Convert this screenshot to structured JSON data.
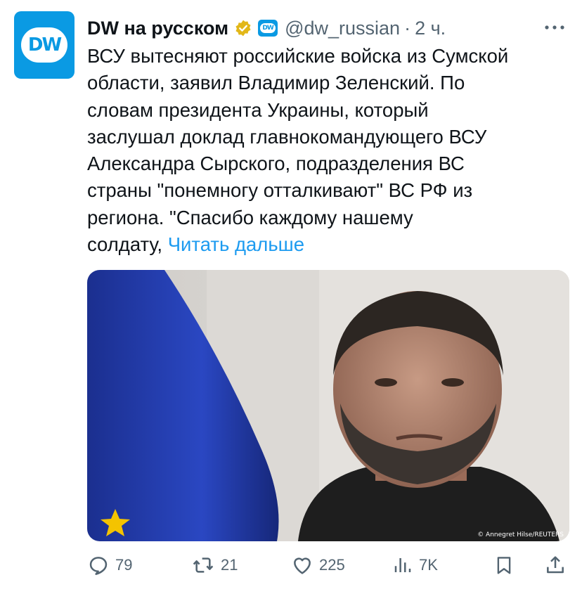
{
  "author": {
    "name": "DW на русском",
    "handle": "@dw_russian",
    "separator": "·",
    "time": "2 ч.",
    "avatar_text": "DW",
    "affiliate_text": "DW"
  },
  "tweet": {
    "lines": [
      "ВСУ вытесняют российские войска из Сумской",
      "области, заявил Владимир Зеленский. По",
      "словам президента Украины, который",
      "заслушал доклад главнокомандующего ВСУ",
      "Александра Сырского, подразделения ВС",
      "страны \"понемногу отталкивают\" ВС РФ из",
      "региона. \"Спасибо каждому нашему",
      "солдату, "
    ],
    "read_more": "Читать дальше"
  },
  "media": {
    "credit": "© Annegret Hilse/REUTERS"
  },
  "actions": {
    "replies": "79",
    "reposts": "21",
    "likes": "225",
    "views": "7K"
  },
  "colors": {
    "accent": "#1d9bf0",
    "brand": "#0a9ae3",
    "muted": "#536471",
    "text": "#0f1419",
    "verified": "#e2b719"
  }
}
